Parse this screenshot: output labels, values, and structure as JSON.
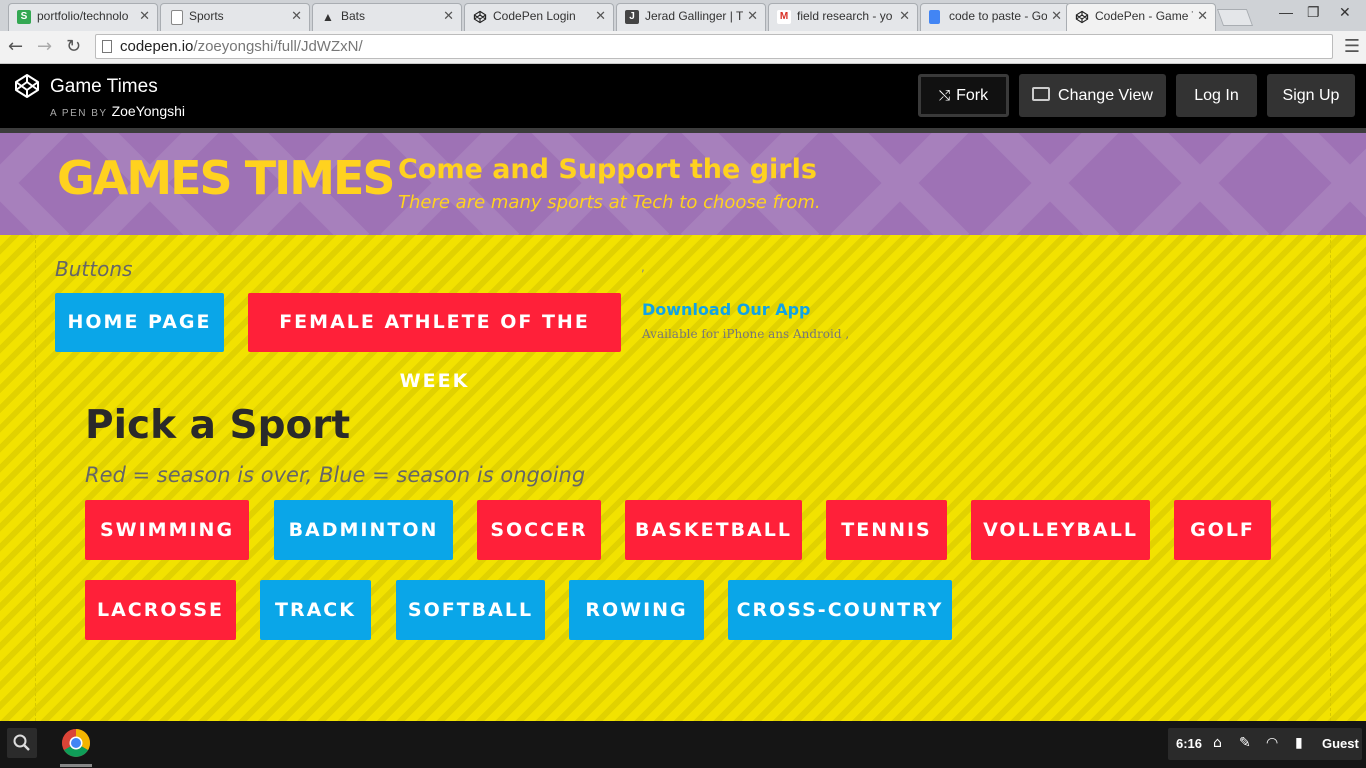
{
  "browser": {
    "tabs": [
      {
        "title": "portfolio/technolo",
        "icon": "sheets-icon",
        "color": "#34a853",
        "glyph": "S",
        "active": false
      },
      {
        "title": "Sports",
        "icon": "page-icon",
        "color": "#ffffff",
        "glyph": "",
        "active": false
      },
      {
        "title": "Bats",
        "icon": "bat-icon",
        "color": "#333333",
        "glyph": "",
        "active": false
      },
      {
        "title": "CodePen Login",
        "icon": "codepen-icon",
        "color": "#222222",
        "glyph": "",
        "active": false
      },
      {
        "title": "Jerad Gallinger | T",
        "icon": "j-icon",
        "color": "#444444",
        "glyph": "J",
        "active": false
      },
      {
        "title": "field research - yo",
        "icon": "gmail-icon",
        "color": "#ffffff",
        "glyph": "M",
        "active": false
      },
      {
        "title": "code to paste - Go",
        "icon": "docs-icon",
        "color": "#4285f4",
        "glyph": "",
        "active": false
      },
      {
        "title": "CodePen - Game T",
        "icon": "codepen-icon",
        "color": "#222222",
        "glyph": "",
        "active": true
      }
    ],
    "url_host": "codepen.io",
    "url_path": "/zoeyongshi/full/JdWZxN/"
  },
  "codepen": {
    "pen_title": "Game Times",
    "by_label": "A PEN BY",
    "author": "ZoeYongshi",
    "buttons": {
      "fork": "Fork",
      "change_view": "Change View",
      "login": "Log In",
      "signup": "Sign Up"
    }
  },
  "banner": {
    "title": "GAMES TIMES",
    "tagline": "Come and Support the girls",
    "subline": "There are many sports at Tech to choose from.",
    "colors": {
      "background": "#9e72b5",
      "text": "#ffd21f"
    }
  },
  "buttons_section": {
    "label": "Buttons",
    "home": "HOME PAGE",
    "athlete": "FEMALE ATHLETE OF THE WEEK",
    "comma": ",",
    "app_title": "Download Our App",
    "app_sub": "Available for iPhone ans Android ,"
  },
  "sports": {
    "title": "Pick a Sport",
    "legend": "Red = season is over, Blue = season is ongoing",
    "colors": {
      "over": "#ff2039",
      "ongoing": "#0aa6e8"
    },
    "row1": [
      {
        "label": "SWIMMING",
        "status": "over"
      },
      {
        "label": "BADMINTON",
        "status": "ongoing"
      },
      {
        "label": "SOCCER",
        "status": "over"
      },
      {
        "label": "BASKETBALL",
        "status": "over"
      },
      {
        "label": "TENNIS",
        "status": "over"
      },
      {
        "label": "VOLLEYBALL",
        "status": "over"
      },
      {
        "label": "GOLF",
        "status": "over"
      }
    ],
    "row2": [
      {
        "label": "LACROSSE",
        "status": "over"
      },
      {
        "label": "TRACK",
        "status": "ongoing"
      },
      {
        "label": "SOFTBALL",
        "status": "ongoing"
      },
      {
        "label": "ROWING",
        "status": "ongoing"
      },
      {
        "label": "CROSS-COUNTRY",
        "status": "ongoing"
      }
    ]
  },
  "shelf": {
    "time": "6:16",
    "user": "Guest"
  }
}
